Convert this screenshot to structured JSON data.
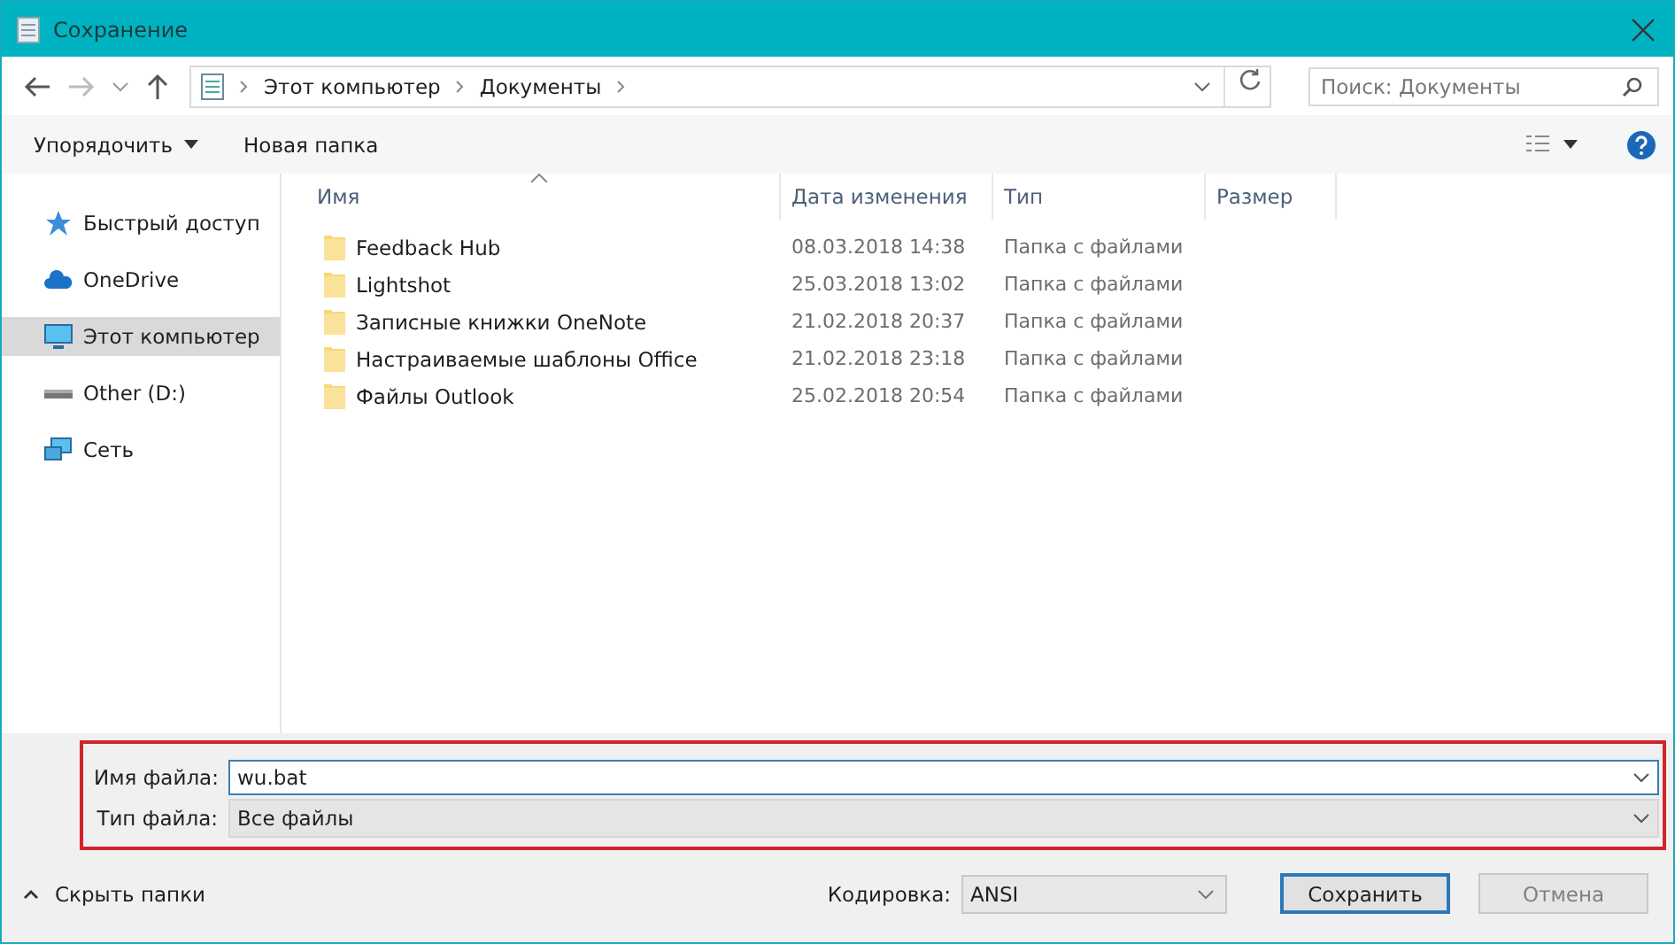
{
  "window": {
    "title": "Сохранение"
  },
  "address": {
    "path": [
      "Этот компьютер",
      "Документы"
    ]
  },
  "search": {
    "placeholder": "Поиск: Документы"
  },
  "toolbar": {
    "organize": "Упорядочить",
    "new_folder": "Новая папка"
  },
  "sidebar": {
    "items": [
      {
        "label": "Быстрый доступ",
        "kind": "star",
        "selected": false
      },
      {
        "label": "OneDrive",
        "kind": "cloud",
        "selected": false
      },
      {
        "label": "Этот компьютер",
        "kind": "computer",
        "selected": true
      },
      {
        "label": "Other (D:)",
        "kind": "drive",
        "selected": false
      },
      {
        "label": "Сеть",
        "kind": "network",
        "selected": false
      }
    ]
  },
  "table": {
    "columns": [
      "Имя",
      "Дата изменения",
      "Тип",
      "Размер"
    ],
    "rows": [
      {
        "name": "Feedback Hub",
        "date": "08.03.2018 14:38",
        "type": "Папка с файлами"
      },
      {
        "name": "Lightshot",
        "date": "25.03.2018 13:02",
        "type": "Папка с файлами"
      },
      {
        "name": "Записные книжки OneNote",
        "date": "21.02.2018 20:37",
        "type": "Папка с файлами"
      },
      {
        "name": "Настраиваемые шаблоны Office",
        "date": "21.02.2018 23:18",
        "type": "Папка с файлами"
      },
      {
        "name": "Файлы Outlook",
        "date": "25.02.2018 20:54",
        "type": "Папка с файлами"
      }
    ]
  },
  "filename": {
    "label": "Имя файла:",
    "value": "wu.bat"
  },
  "filetype": {
    "label": "Тип файла:",
    "value": "Все файлы"
  },
  "hide_folders": "Скрыть папки",
  "encoding": {
    "label": "Кодировка:",
    "value": "ANSI"
  },
  "buttons": [
    {
      "label": "Сохранить",
      "kind": "primary"
    },
    {
      "label": "Отмена",
      "kind": "secondary"
    }
  ]
}
